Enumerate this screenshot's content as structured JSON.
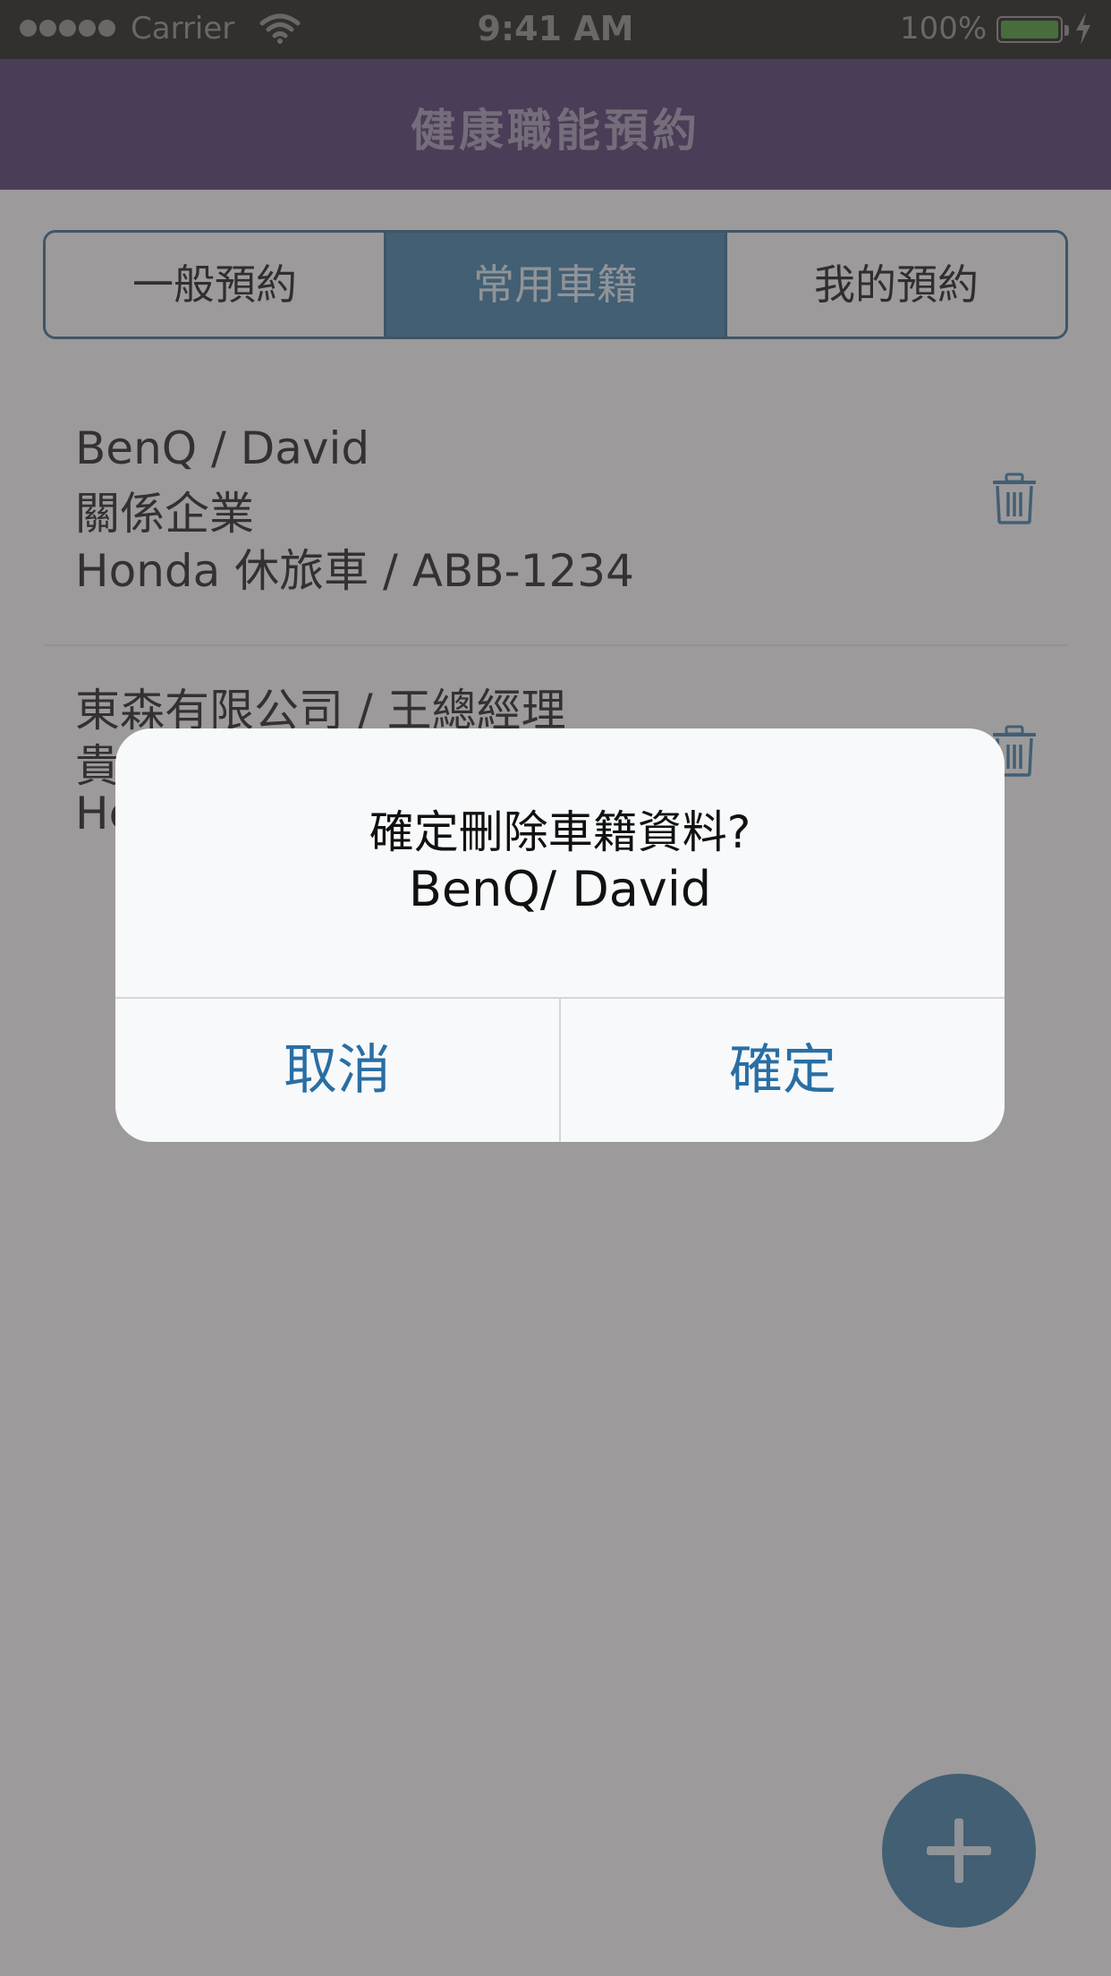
{
  "status_bar": {
    "carrier": "Carrier",
    "time": "9:41 AM",
    "battery_percent_label": "100%",
    "battery_level": 1.0,
    "signal_dots": 5,
    "icons": [
      "signal-dots-icon",
      "wifi-icon",
      "battery-icon",
      "charging-bolt-icon"
    ]
  },
  "nav": {
    "title": "健康職能預約"
  },
  "tabs": [
    {
      "label": "一般預約",
      "active": false
    },
    {
      "label": "常用車籍",
      "active": true
    },
    {
      "label": "我的預約",
      "active": false
    }
  ],
  "vehicles": [
    {
      "line1": "BenQ / David",
      "line2": "關係企業",
      "line3": "Honda 休旅車 / ABB-1234",
      "icon": "trash-icon"
    },
    {
      "line1": "東森有限公司 / 王總經理",
      "line2": "貴",
      "line3": "He",
      "icon": "trash-icon"
    }
  ],
  "fab": {
    "icon": "plus-icon"
  },
  "dialog": {
    "title": "確定刪除車籍資料?",
    "subtitle": "BenQ/ David",
    "cancel_label": "取消",
    "confirm_label": "確定"
  },
  "colors": {
    "nav_bar": "#4f3b6e",
    "accent": "#3f7fa8",
    "dialog_button_text": "#2a6ea3",
    "overlay": "rgba(70,64,64,0.5)"
  }
}
